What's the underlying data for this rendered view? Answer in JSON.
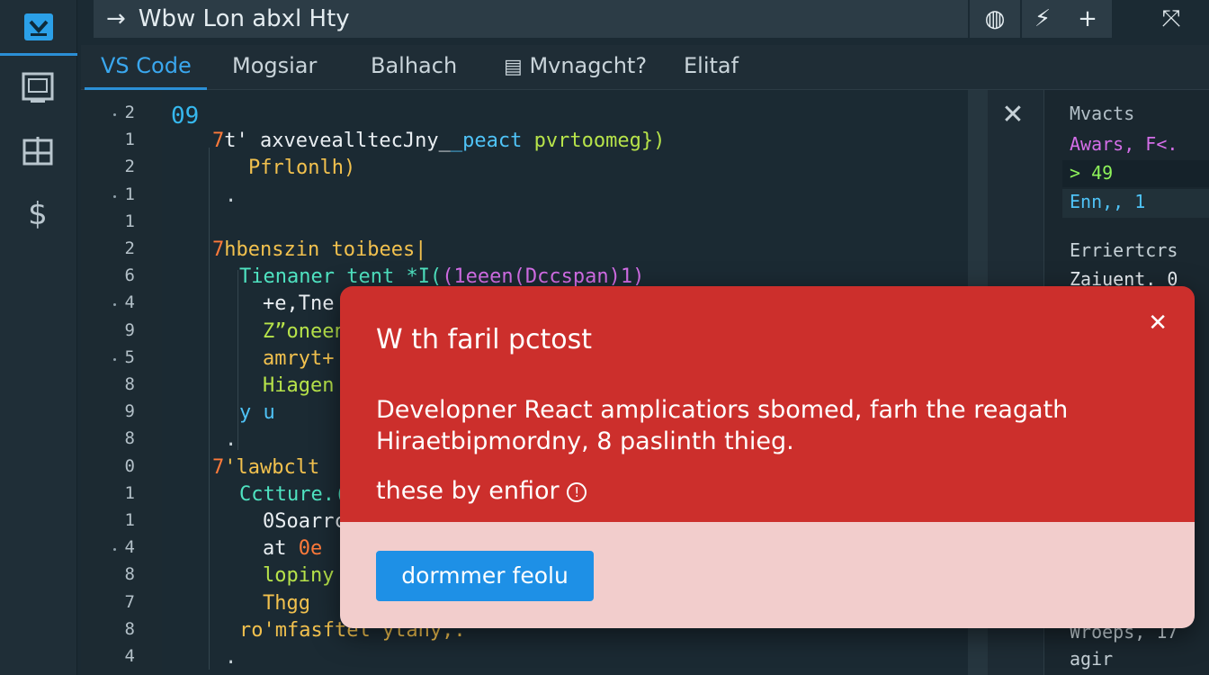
{
  "window": {
    "title": "Wbw Lon abxl Hty",
    "back_icon": "arrow-right-icon",
    "actions": [
      {
        "icon": "globe-icon",
        "glyph": "◍"
      },
      {
        "icon": "lightning-icon",
        "glyph": "⚡"
      },
      {
        "icon": "plus-icon",
        "glyph": "+"
      },
      {
        "icon": "split-icon",
        "glyph": "⤧"
      }
    ]
  },
  "tabs": [
    {
      "label": "VS Code",
      "active": true
    },
    {
      "label": "Mogsiar"
    },
    {
      "label": "Balhach"
    },
    {
      "label": "Mvnagcht?"
    },
    {
      "label": "Elitaf"
    }
  ],
  "activity": {
    "icons": [
      "logo-icon",
      "monitor-icon",
      "grid-icon",
      "dollar-icon"
    ]
  },
  "editor": {
    "line_numbers": [
      "2",
      "1",
      "2",
      "1",
      "1",
      "2",
      "6",
      "4",
      "9",
      "5",
      "8",
      "9",
      "8",
      "0",
      "1",
      "1",
      "4",
      "8",
      "7",
      "8",
      "4"
    ],
    "lines": [
      {
        "parts": [
          {
            "t": "09",
            "c": "#36b8ee"
          }
        ]
      },
      {
        "parts": [
          {
            "t": "7",
            "c": "#ff7a3a"
          },
          {
            "t": "t' axvevealltecJny_",
            "c": "#e9eef2"
          },
          {
            "t": "_peact ",
            "c": "#4fc3f7"
          },
          {
            "t": "pvrtoomeg})",
            "c": "#b7e34a"
          }
        ]
      },
      {
        "parts": [
          {
            "t": "Pfrlonlh)",
            "c": "#f2c14e"
          }
        ]
      },
      {
        "parts": [
          {
            "t": ".",
            "c": "#c6d1d7"
          }
        ]
      },
      {
        "parts": [
          {
            "t": "",
            "c": "#c6d1d7"
          }
        ]
      },
      {
        "parts": [
          {
            "t": "7",
            "c": "#ff7a3a"
          },
          {
            "t": "hbenszin ",
            "c": "#f2c14e"
          },
          {
            "t": "toibees|",
            "c": "#f2c14e"
          }
        ]
      },
      {
        "parts": [
          {
            "t": "Tienaner ",
            "c": "#4fe3c1"
          },
          {
            "t": "tent *I(",
            "c": "#4fe3c1"
          },
          {
            "t": "(1eeen(Dccspan)1)",
            "c": "#d46ee8"
          }
        ]
      },
      {
        "parts": [
          {
            "t": "+e,Tne",
            "c": "#e9eef2"
          }
        ]
      },
      {
        "parts": [
          {
            "t": "Z”oneen",
            "c": "#b7e34a"
          }
        ]
      },
      {
        "parts": [
          {
            "t": "amryt+",
            "c": "#f2c14e"
          }
        ]
      },
      {
        "parts": [
          {
            "t": "Hiagen",
            "c": "#b7e34a"
          }
        ]
      },
      {
        "parts": [
          {
            "t": "y u",
            "c": "#4fc3f7"
          }
        ]
      },
      {
        "parts": [
          {
            "t": ".",
            "c": "#c6d1d7"
          }
        ]
      },
      {
        "parts": [
          {
            "t": "7",
            "c": "#ff7a3a"
          },
          {
            "t": "'lawbclt",
            "c": "#f2c14e"
          }
        ]
      },
      {
        "parts": [
          {
            "t": "Cctture.(",
            "c": "#4fe3c1"
          }
        ]
      },
      {
        "parts": [
          {
            "t": "0Soarrc",
            "c": "#e9eef2"
          }
        ]
      },
      {
        "parts": [
          {
            "t": "at ",
            "c": "#e9eef2"
          },
          {
            "t": "0e",
            "c": "#ff7a3a"
          }
        ]
      },
      {
        "parts": [
          {
            "t": "lopiny",
            "c": "#b7e34a"
          }
        ]
      },
      {
        "parts": [
          {
            "t": "Thgg",
            "c": "#f2c14e"
          }
        ]
      },
      {
        "parts": [
          {
            "t": "ro'mfasftel ytany,.",
            "c": "#f2c14e"
          }
        ]
      },
      {
        "parts": [
          {
            "t": ".",
            "c": "#c6d1d7"
          }
        ]
      }
    ]
  },
  "panel": {
    "close_icon": "close-icon",
    "heading": "Mvacts",
    "rows": [
      {
        "t": "Awars, F<.",
        "c": "#d46ee8"
      },
      {
        "t": "> 49",
        "c": "#8ef35a"
      },
      {
        "t": "Enn,, 1",
        "c": "#4fc3f7"
      },
      {
        "t": "Erriertcrs",
        "c": "#c6d1d7"
      },
      {
        "t": "Zaiuent. 0",
        "c": "#e9eef2"
      },
      {
        "t": "Wroeps, 17",
        "c": "#c6d1d7"
      },
      {
        "t": "agir",
        "c": "#c6d1d7"
      }
    ]
  },
  "dialog": {
    "title": "W th faril pctost",
    "close_icon": "close-icon",
    "body_line1": "Developner React amplicatiors sbomed, farh the reagath",
    "body_line2": "Hiraetbipmordny, 8 paslinth thieg.",
    "sub": "these by enfior",
    "info_icon": "info-icon",
    "button_label": "dormmer feolu"
  }
}
